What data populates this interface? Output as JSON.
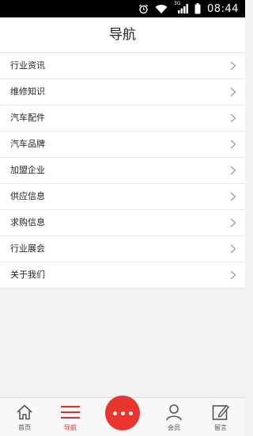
{
  "status_bar": {
    "time": "08:44",
    "network": "3G"
  },
  "header": {
    "title": "导航"
  },
  "menu": {
    "items": [
      {
        "label": "行业资讯"
      },
      {
        "label": "维修知识"
      },
      {
        "label": "汽车配件"
      },
      {
        "label": "汽车品牌"
      },
      {
        "label": "加盟企业"
      },
      {
        "label": "供应信息"
      },
      {
        "label": "求购信息"
      },
      {
        "label": "行业展会"
      },
      {
        "label": "关于我们"
      }
    ]
  },
  "tabbar": {
    "home": "首页",
    "nav": "导航",
    "member": "会员",
    "message": "留言"
  },
  "colors": {
    "accent": "#e8362f",
    "active_text": "#d8302c"
  }
}
